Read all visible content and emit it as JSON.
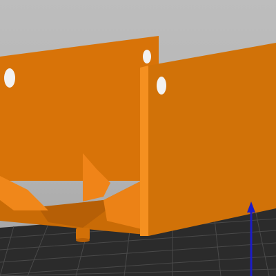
{
  "viewport": {
    "background_color": "#b9b9b9"
  },
  "scene": {
    "build_plate_color": "#2b2b2b",
    "grid_line_color": "#4a4a4a",
    "model_color": "#e07a0e",
    "model_shadow_color": "#b85f07",
    "model_dark_color": "#9a4c05",
    "z_axis_color": "#1c1cc8"
  },
  "gizmo": {
    "axis": "z-axis-arrow-icon"
  }
}
